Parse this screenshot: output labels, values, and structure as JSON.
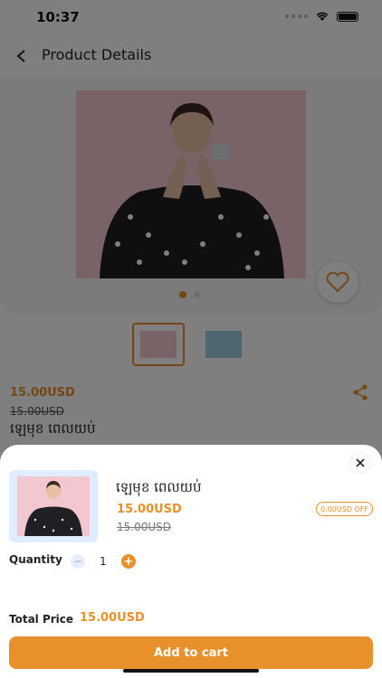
{
  "status": {
    "time": "10:37"
  },
  "header": {
    "title": "Product Details"
  },
  "product": {
    "price": "15.00USD",
    "old_price": "15.00USD",
    "name": "ឡេមុខ ពេលយប់"
  },
  "gallery": {
    "image_count": 2,
    "active_index": 0
  },
  "sheet": {
    "name": "ឡេមុខ ពេលយប់",
    "price": "15.00USD",
    "old_price": "15.00USD",
    "discount_badge": "0.00USD OFF",
    "quantity_label": "Quantity",
    "quantity_value": "1",
    "minus_symbol": "−",
    "plus_symbol": "+",
    "total_label": "Total Price",
    "total_value": "15.00USD",
    "add_button": "Add to cart"
  },
  "colors": {
    "accent": "#e8902a",
    "overlay": "rgba(0,0,0,0.5)"
  }
}
